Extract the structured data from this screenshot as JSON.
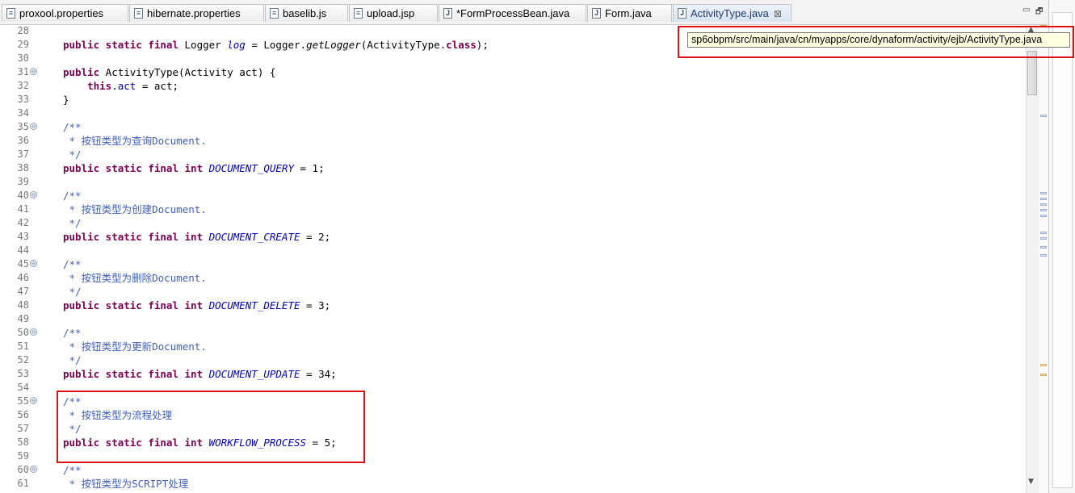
{
  "tabs": [
    {
      "label": "proxool.properties",
      "icon": "properties-file-icon",
      "glyph": "≡"
    },
    {
      "label": "hibernate.properties",
      "icon": "properties-file-icon",
      "glyph": "≡"
    },
    {
      "label": "baselib.js",
      "icon": "js-file-icon",
      "glyph": "≡"
    },
    {
      "label": "upload.jsp",
      "icon": "jsp-file-icon",
      "glyph": "≡"
    },
    {
      "label": "*FormProcessBean.java",
      "icon": "java-file-icon",
      "glyph": "J"
    },
    {
      "label": "Form.java",
      "icon": "java-file-icon",
      "glyph": "J"
    },
    {
      "label": "ActivityType.java",
      "icon": "java-file-icon",
      "glyph": "J",
      "close": "⊠"
    }
  ],
  "window_controls": {
    "minimize": "▭",
    "restore": "🗗"
  },
  "tooltip": "sp6obpm/src/main/java/cn/myapps/core/dynaform/activity/ejb/ActivityType.java",
  "highlight_color": "#e01010",
  "code_lines": [
    {
      "n": "28",
      "fold": "",
      "s": []
    },
    {
      "n": "29",
      "fold": "",
      "s": [
        {
          "t": "public static final",
          "c": "kw"
        },
        {
          "t": " Logger "
        },
        {
          "t": "log",
          "c": "fi"
        },
        {
          "t": " = Logger."
        },
        {
          "t": "getLogger",
          "c": "mi"
        },
        {
          "t": "(ActivityType."
        },
        {
          "t": "class",
          "c": "kw"
        },
        {
          "t": ");"
        }
      ]
    },
    {
      "n": "30",
      "fold": "",
      "s": []
    },
    {
      "n": "31",
      "fold": "⊖",
      "s": [
        {
          "t": "public",
          "c": "kw"
        },
        {
          "t": " ActivityType(Activity act) {"
        }
      ]
    },
    {
      "n": "32",
      "fold": "",
      "s": [
        {
          "t": "    "
        },
        {
          "t": "this",
          "c": "kw"
        },
        {
          "t": "."
        },
        {
          "t": "act",
          "c": "ff"
        },
        {
          "t": " = act;"
        }
      ]
    },
    {
      "n": "33",
      "fold": "",
      "s": [
        {
          "t": "}"
        }
      ]
    },
    {
      "n": "34",
      "fold": "",
      "s": []
    },
    {
      "n": "35",
      "fold": "⊖",
      "s": [
        {
          "t": "/**",
          "c": "cm"
        }
      ]
    },
    {
      "n": "36",
      "fold": "",
      "s": [
        {
          "t": " * 按钮类型为查询Document.",
          "c": "cm"
        }
      ]
    },
    {
      "n": "37",
      "fold": "",
      "s": [
        {
          "t": " */",
          "c": "cm"
        }
      ]
    },
    {
      "n": "38",
      "fold": "",
      "s": [
        {
          "t": "public static final int",
          "c": "kw"
        },
        {
          "t": " "
        },
        {
          "t": "DOCUMENT_QUERY",
          "c": "fi"
        },
        {
          "t": " = 1;"
        }
      ]
    },
    {
      "n": "39",
      "fold": "",
      "s": []
    },
    {
      "n": "40",
      "fold": "⊖",
      "s": [
        {
          "t": "/**",
          "c": "cm"
        }
      ]
    },
    {
      "n": "41",
      "fold": "",
      "s": [
        {
          "t": " * 按钮类型为创建Document.",
          "c": "cm"
        }
      ]
    },
    {
      "n": "42",
      "fold": "",
      "s": [
        {
          "t": " */",
          "c": "cm"
        }
      ]
    },
    {
      "n": "43",
      "fold": "",
      "s": [
        {
          "t": "public static final int",
          "c": "kw"
        },
        {
          "t": " "
        },
        {
          "t": "DOCUMENT_CREATE",
          "c": "fi"
        },
        {
          "t": " = 2;"
        }
      ]
    },
    {
      "n": "44",
      "fold": "",
      "s": []
    },
    {
      "n": "45",
      "fold": "⊖",
      "s": [
        {
          "t": "/**",
          "c": "cm"
        }
      ]
    },
    {
      "n": "46",
      "fold": "",
      "s": [
        {
          "t": " * 按钮类型为删除Document.",
          "c": "cm"
        }
      ]
    },
    {
      "n": "47",
      "fold": "",
      "s": [
        {
          "t": " */",
          "c": "cm"
        }
      ]
    },
    {
      "n": "48",
      "fold": "",
      "s": [
        {
          "t": "public static final int",
          "c": "kw"
        },
        {
          "t": " "
        },
        {
          "t": "DOCUMENT_DELETE",
          "c": "fi"
        },
        {
          "t": " = 3;"
        }
      ]
    },
    {
      "n": "49",
      "fold": "",
      "s": []
    },
    {
      "n": "50",
      "fold": "⊖",
      "s": [
        {
          "t": "/**",
          "c": "cm"
        }
      ]
    },
    {
      "n": "51",
      "fold": "",
      "s": [
        {
          "t": " * 按钮类型为更新Document.",
          "c": "cm"
        }
      ]
    },
    {
      "n": "52",
      "fold": "",
      "s": [
        {
          "t": " */",
          "c": "cm"
        }
      ]
    },
    {
      "n": "53",
      "fold": "",
      "s": [
        {
          "t": "public static final int",
          "c": "kw"
        },
        {
          "t": " "
        },
        {
          "t": "DOCUMENT_UPDATE",
          "c": "fi"
        },
        {
          "t": " = 34;"
        }
      ]
    },
    {
      "n": "54",
      "fold": "",
      "s": []
    },
    {
      "n": "55",
      "fold": "⊖",
      "s": [
        {
          "t": "/**",
          "c": "cm"
        }
      ]
    },
    {
      "n": "56",
      "fold": "",
      "s": [
        {
          "t": " * 按钮类型为流程处理",
          "c": "cm"
        }
      ]
    },
    {
      "n": "57",
      "fold": "",
      "s": [
        {
          "t": " */",
          "c": "cm"
        }
      ]
    },
    {
      "n": "58",
      "fold": "",
      "s": [
        {
          "t": "public static final int",
          "c": "kw"
        },
        {
          "t": " "
        },
        {
          "t": "WORKFLOW_PROCESS",
          "c": "fi"
        },
        {
          "t": " = 5;"
        }
      ]
    },
    {
      "n": "59",
      "fold": "",
      "s": []
    },
    {
      "n": "60",
      "fold": "⊖",
      "s": [
        {
          "t": "/**",
          "c": "cm"
        }
      ]
    },
    {
      "n": "61",
      "fold": "",
      "s": [
        {
          "t": " * 按钮类型为SCRIPT处理",
          "c": "cm"
        }
      ]
    }
  ],
  "scrollbar": {
    "up": "▲",
    "down": "▼"
  }
}
